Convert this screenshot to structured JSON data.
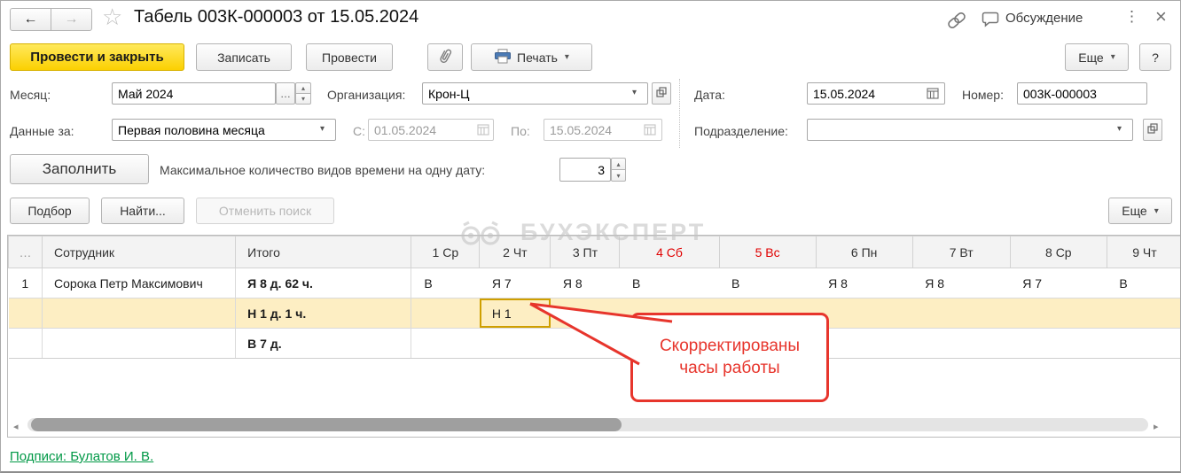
{
  "window": {
    "title": "Табель 003К-000003 от 15.05.2024",
    "discussion": "Обсуждение"
  },
  "icons": {
    "back": "←",
    "forward": "→",
    "star": "☆",
    "menu_dots": "⋮",
    "close": "×",
    "caret": "▾",
    "ellipsis_button": "…",
    "spin_up": "▴",
    "spin_down": "▾",
    "scroll_left": "◂",
    "scroll_right": "▸"
  },
  "command_bar": {
    "post_and_close": "Провести и закрыть",
    "save": "Записать",
    "post": "Провести",
    "print": "Печать",
    "more": "Еще",
    "help": "?"
  },
  "filters": {
    "month": {
      "label": "Месяц:",
      "value": "Май 2024"
    },
    "organization": {
      "label": "Организация:",
      "value": "Крон-Ц"
    },
    "date": {
      "label": "Дата:",
      "value": "15.05.2024"
    },
    "number": {
      "label": "Номер:",
      "value": "003К-000003"
    },
    "data_for": {
      "label": "Данные за:",
      "value": "Первая половина месяца"
    },
    "period_from": {
      "label": "С:",
      "value": "01.05.2024"
    },
    "period_to": {
      "label": "По:",
      "value": "15.05.2024"
    },
    "department": {
      "label": "Подразделение:",
      "value": ""
    }
  },
  "fill_row": {
    "fill": "Заполнить",
    "max_types_label": "Максимальное количество видов времени на одну дату:",
    "max_types_value": "3"
  },
  "search_row": {
    "pick": "Подбор",
    "find": "Найти...",
    "cancel": "Отменить поиск",
    "more": "Еще"
  },
  "table": {
    "col_num": "…",
    "col_employee": "Сотрудник",
    "col_total": "Итого",
    "days": [
      {
        "label": "1 Ср",
        "weekend": false
      },
      {
        "label": "2 Чт",
        "weekend": false
      },
      {
        "label": "3 Пт",
        "weekend": false
      },
      {
        "label": "4 Сб",
        "weekend": true
      },
      {
        "label": "5 Вс",
        "weekend": true
      },
      {
        "label": "6 Пн",
        "weekend": false
      },
      {
        "label": "7 Вт",
        "weekend": false
      },
      {
        "label": "8 Ср",
        "weekend": false
      },
      {
        "label": "9 Чт",
        "weekend": false
      }
    ],
    "rows": [
      {
        "num": "1",
        "employee": "Сорока Петр Максимович",
        "total": "Я 8 д. 62 ч.",
        "days": [
          "В",
          "Я 7",
          "Я 8",
          "В",
          "В",
          "Я 8",
          "Я 8",
          "Я 7",
          "В"
        ]
      },
      {
        "num": "",
        "employee": "",
        "total": "Н 1 д. 1 ч.",
        "days": [
          "",
          "Н 1",
          "",
          "",
          "",
          "",
          "",
          "",
          ""
        ]
      },
      {
        "num": "",
        "employee": "",
        "total": "В 7 д.",
        "days": [
          "",
          "",
          "",
          "",
          "",
          "",
          "",
          "",
          ""
        ]
      }
    ]
  },
  "callout": {
    "line1": "Скорректированы",
    "line2": "часы работы"
  },
  "watermark": "БУХЭКСПЕРТ",
  "signatures": "Подписи: Булатов И. В.",
  "colors": {
    "accent_yellow": "#fbd001",
    "weekend_red": "#e00000",
    "callout_red": "#e7352c",
    "link_green": "#009846",
    "row_highlight": "#fdeec3",
    "selected_cell_border": "#cf9f00"
  }
}
